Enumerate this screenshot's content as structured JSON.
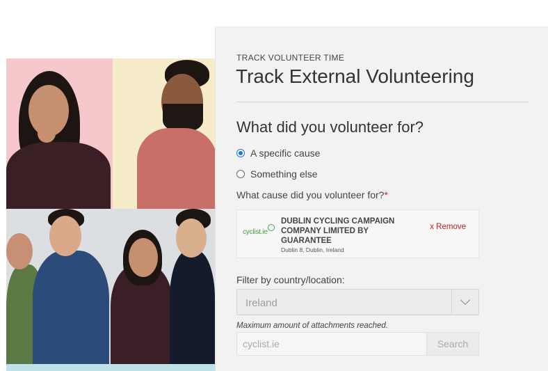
{
  "panel": {
    "eyebrow": "TRACK VOLUNTEER TIME",
    "title": "Track External Volunteering",
    "question": "What did you volunteer for?",
    "options": [
      {
        "label": "A specific cause",
        "selected": true
      },
      {
        "label": "Something else",
        "selected": false
      }
    ],
    "cause_label": "What cause did you volunteer for?",
    "required_mark": "*",
    "cause": {
      "logo_text": "cyclist.ie",
      "name": "DUBLIN CYCLING CAMPAIGN COMPANY LIMITED BY GUARANTEE",
      "location": "Dublin 8, Dublin, Ireland",
      "remove_label": "x Remove"
    },
    "filter_label": "Filter by country/location:",
    "country_value": "Ireland",
    "attachments_note": "Maximum amount of attachments reached.",
    "search_value": "cyclist.ie",
    "search_button": "Search"
  },
  "colors": {
    "accent": "#1a73e8",
    "remove": "#b22222",
    "panel_bg": "#f2f2f2"
  },
  "icons": [
    "radio-selected-icon",
    "radio-unselected-icon",
    "chevron-down-icon",
    "cyclist-logo"
  ]
}
